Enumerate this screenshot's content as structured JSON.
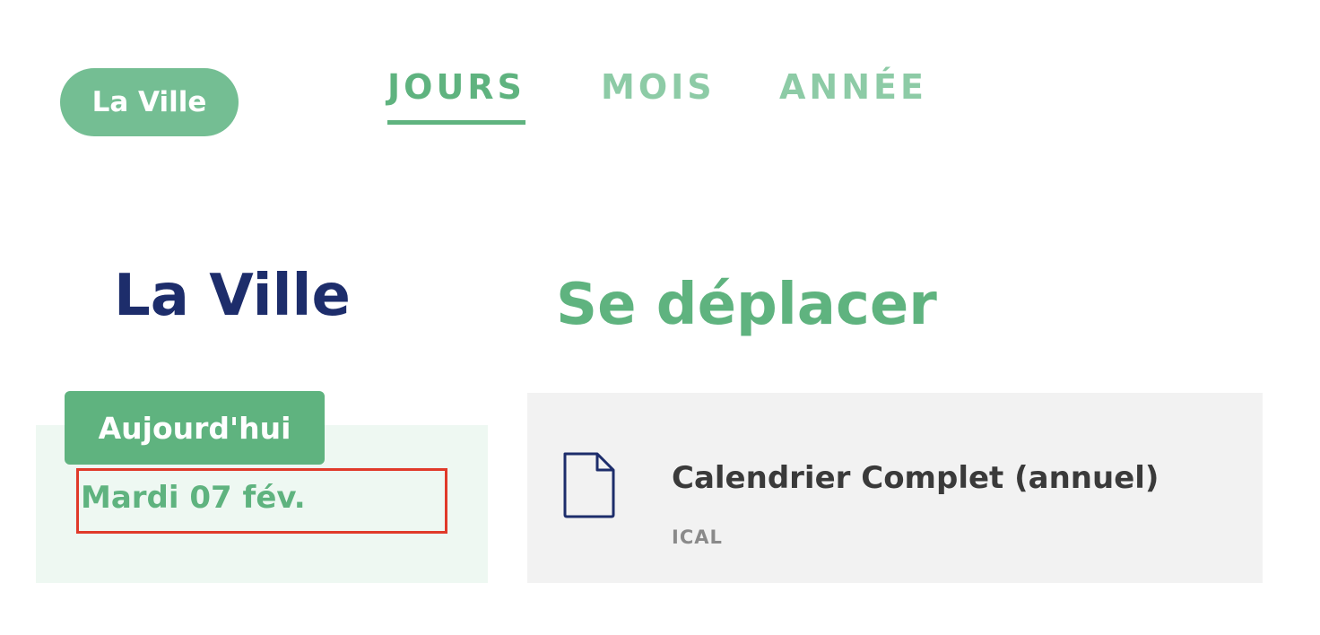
{
  "header": {
    "pill_label": "La Ville",
    "tabs": [
      {
        "label": "JOURS",
        "active": true
      },
      {
        "label": "MOIS",
        "active": false
      },
      {
        "label": "ANNÉE",
        "active": false
      }
    ]
  },
  "page": {
    "city_heading": "La Ville",
    "section_heading": "Se déplacer"
  },
  "today": {
    "badge_label": "Aujourd'hui",
    "date_label": "Mardi 07 fév."
  },
  "download": {
    "title": "Calendrier Complet (annuel)",
    "file_type": "ICAL",
    "icon": "file-icon"
  },
  "colors": {
    "brand_green": "#5fb37f",
    "light_green": "#8dcba6",
    "navy": "#1d2d6b",
    "highlight_red": "#e03a2a"
  }
}
